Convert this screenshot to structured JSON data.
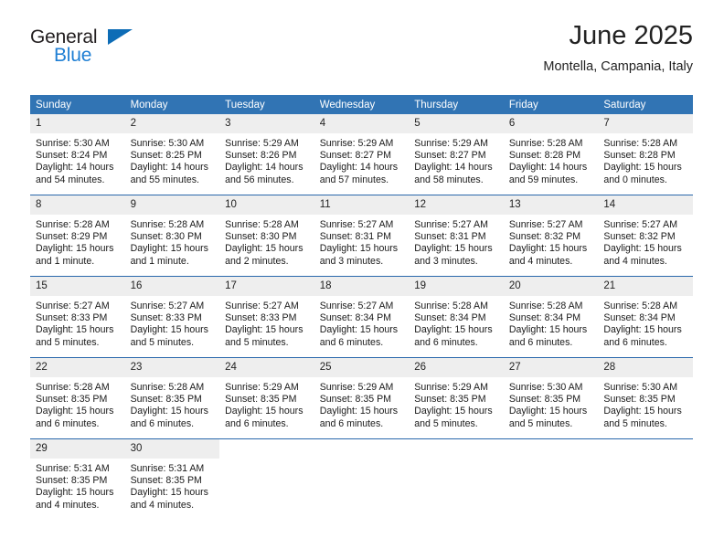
{
  "brand": {
    "line1": "General",
    "line2": "Blue",
    "accent_dark": "#0d6cb6",
    "accent_light": "#1f7fd4"
  },
  "header": {
    "title": "June 2025",
    "subtitle": "Montella, Campania, Italy"
  },
  "theme": {
    "header_blue": "#3174b4",
    "rule_blue": "#2a68ac",
    "daynum_bg": "#eeeeee"
  },
  "weekday_headers": [
    "Sunday",
    "Monday",
    "Tuesday",
    "Wednesday",
    "Thursday",
    "Friday",
    "Saturday"
  ],
  "weeks": [
    [
      {
        "day": "1",
        "sunrise": "Sunrise: 5:30 AM",
        "sunset": "Sunset: 8:24 PM",
        "daylight1": "Daylight: 14 hours",
        "daylight2": "and 54 minutes."
      },
      {
        "day": "2",
        "sunrise": "Sunrise: 5:30 AM",
        "sunset": "Sunset: 8:25 PM",
        "daylight1": "Daylight: 14 hours",
        "daylight2": "and 55 minutes."
      },
      {
        "day": "3",
        "sunrise": "Sunrise: 5:29 AM",
        "sunset": "Sunset: 8:26 PM",
        "daylight1": "Daylight: 14 hours",
        "daylight2": "and 56 minutes."
      },
      {
        "day": "4",
        "sunrise": "Sunrise: 5:29 AM",
        "sunset": "Sunset: 8:27 PM",
        "daylight1": "Daylight: 14 hours",
        "daylight2": "and 57 minutes."
      },
      {
        "day": "5",
        "sunrise": "Sunrise: 5:29 AM",
        "sunset": "Sunset: 8:27 PM",
        "daylight1": "Daylight: 14 hours",
        "daylight2": "and 58 minutes."
      },
      {
        "day": "6",
        "sunrise": "Sunrise: 5:28 AM",
        "sunset": "Sunset: 8:28 PM",
        "daylight1": "Daylight: 14 hours",
        "daylight2": "and 59 minutes."
      },
      {
        "day": "7",
        "sunrise": "Sunrise: 5:28 AM",
        "sunset": "Sunset: 8:28 PM",
        "daylight1": "Daylight: 15 hours",
        "daylight2": "and 0 minutes."
      }
    ],
    [
      {
        "day": "8",
        "sunrise": "Sunrise: 5:28 AM",
        "sunset": "Sunset: 8:29 PM",
        "daylight1": "Daylight: 15 hours",
        "daylight2": "and 1 minute."
      },
      {
        "day": "9",
        "sunrise": "Sunrise: 5:28 AM",
        "sunset": "Sunset: 8:30 PM",
        "daylight1": "Daylight: 15 hours",
        "daylight2": "and 1 minute."
      },
      {
        "day": "10",
        "sunrise": "Sunrise: 5:28 AM",
        "sunset": "Sunset: 8:30 PM",
        "daylight1": "Daylight: 15 hours",
        "daylight2": "and 2 minutes."
      },
      {
        "day": "11",
        "sunrise": "Sunrise: 5:27 AM",
        "sunset": "Sunset: 8:31 PM",
        "daylight1": "Daylight: 15 hours",
        "daylight2": "and 3 minutes."
      },
      {
        "day": "12",
        "sunrise": "Sunrise: 5:27 AM",
        "sunset": "Sunset: 8:31 PM",
        "daylight1": "Daylight: 15 hours",
        "daylight2": "and 3 minutes."
      },
      {
        "day": "13",
        "sunrise": "Sunrise: 5:27 AM",
        "sunset": "Sunset: 8:32 PM",
        "daylight1": "Daylight: 15 hours",
        "daylight2": "and 4 minutes."
      },
      {
        "day": "14",
        "sunrise": "Sunrise: 5:27 AM",
        "sunset": "Sunset: 8:32 PM",
        "daylight1": "Daylight: 15 hours",
        "daylight2": "and 4 minutes."
      }
    ],
    [
      {
        "day": "15",
        "sunrise": "Sunrise: 5:27 AM",
        "sunset": "Sunset: 8:33 PM",
        "daylight1": "Daylight: 15 hours",
        "daylight2": "and 5 minutes."
      },
      {
        "day": "16",
        "sunrise": "Sunrise: 5:27 AM",
        "sunset": "Sunset: 8:33 PM",
        "daylight1": "Daylight: 15 hours",
        "daylight2": "and 5 minutes."
      },
      {
        "day": "17",
        "sunrise": "Sunrise: 5:27 AM",
        "sunset": "Sunset: 8:33 PM",
        "daylight1": "Daylight: 15 hours",
        "daylight2": "and 5 minutes."
      },
      {
        "day": "18",
        "sunrise": "Sunrise: 5:27 AM",
        "sunset": "Sunset: 8:34 PM",
        "daylight1": "Daylight: 15 hours",
        "daylight2": "and 6 minutes."
      },
      {
        "day": "19",
        "sunrise": "Sunrise: 5:28 AM",
        "sunset": "Sunset: 8:34 PM",
        "daylight1": "Daylight: 15 hours",
        "daylight2": "and 6 minutes."
      },
      {
        "day": "20",
        "sunrise": "Sunrise: 5:28 AM",
        "sunset": "Sunset: 8:34 PM",
        "daylight1": "Daylight: 15 hours",
        "daylight2": "and 6 minutes."
      },
      {
        "day": "21",
        "sunrise": "Sunrise: 5:28 AM",
        "sunset": "Sunset: 8:34 PM",
        "daylight1": "Daylight: 15 hours",
        "daylight2": "and 6 minutes."
      }
    ],
    [
      {
        "day": "22",
        "sunrise": "Sunrise: 5:28 AM",
        "sunset": "Sunset: 8:35 PM",
        "daylight1": "Daylight: 15 hours",
        "daylight2": "and 6 minutes."
      },
      {
        "day": "23",
        "sunrise": "Sunrise: 5:28 AM",
        "sunset": "Sunset: 8:35 PM",
        "daylight1": "Daylight: 15 hours",
        "daylight2": "and 6 minutes."
      },
      {
        "day": "24",
        "sunrise": "Sunrise: 5:29 AM",
        "sunset": "Sunset: 8:35 PM",
        "daylight1": "Daylight: 15 hours",
        "daylight2": "and 6 minutes."
      },
      {
        "day": "25",
        "sunrise": "Sunrise: 5:29 AM",
        "sunset": "Sunset: 8:35 PM",
        "daylight1": "Daylight: 15 hours",
        "daylight2": "and 6 minutes."
      },
      {
        "day": "26",
        "sunrise": "Sunrise: 5:29 AM",
        "sunset": "Sunset: 8:35 PM",
        "daylight1": "Daylight: 15 hours",
        "daylight2": "and 5 minutes."
      },
      {
        "day": "27",
        "sunrise": "Sunrise: 5:30 AM",
        "sunset": "Sunset: 8:35 PM",
        "daylight1": "Daylight: 15 hours",
        "daylight2": "and 5 minutes."
      },
      {
        "day": "28",
        "sunrise": "Sunrise: 5:30 AM",
        "sunset": "Sunset: 8:35 PM",
        "daylight1": "Daylight: 15 hours",
        "daylight2": "and 5 minutes."
      }
    ],
    [
      {
        "day": "29",
        "sunrise": "Sunrise: 5:31 AM",
        "sunset": "Sunset: 8:35 PM",
        "daylight1": "Daylight: 15 hours",
        "daylight2": "and 4 minutes."
      },
      {
        "day": "30",
        "sunrise": "Sunrise: 5:31 AM",
        "sunset": "Sunset: 8:35 PM",
        "daylight1": "Daylight: 15 hours",
        "daylight2": "and 4 minutes."
      },
      {
        "day": "",
        "sunrise": "",
        "sunset": "",
        "daylight1": "",
        "daylight2": ""
      },
      {
        "day": "",
        "sunrise": "",
        "sunset": "",
        "daylight1": "",
        "daylight2": ""
      },
      {
        "day": "",
        "sunrise": "",
        "sunset": "",
        "daylight1": "",
        "daylight2": ""
      },
      {
        "day": "",
        "sunrise": "",
        "sunset": "",
        "daylight1": "",
        "daylight2": ""
      },
      {
        "day": "",
        "sunrise": "",
        "sunset": "",
        "daylight1": "",
        "daylight2": ""
      }
    ]
  ]
}
